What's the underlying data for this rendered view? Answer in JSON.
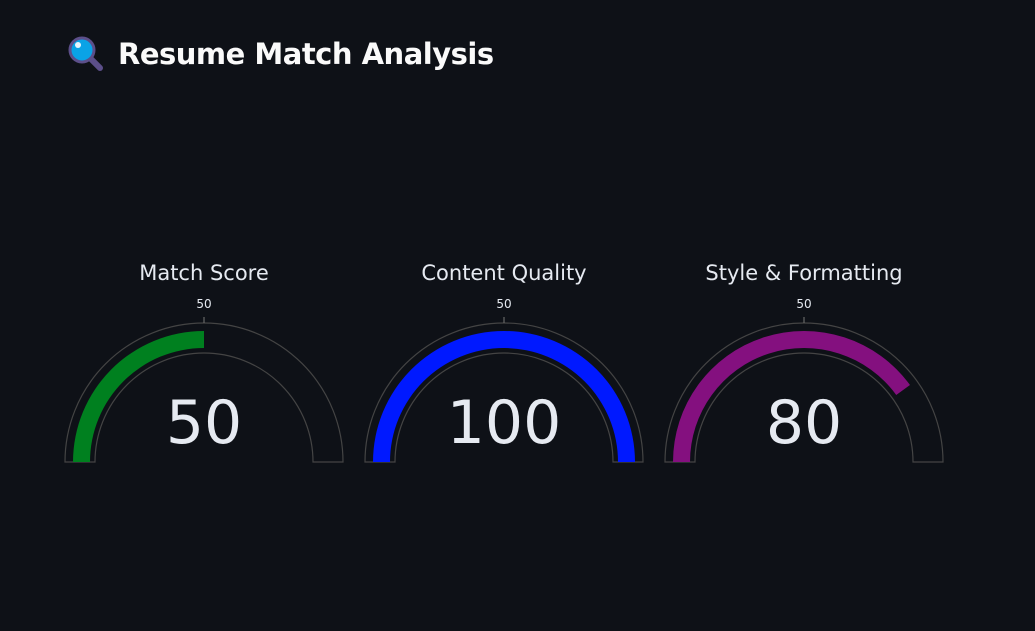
{
  "header": {
    "icon": "magnifying-glass-icon",
    "title": "Resume Match Analysis"
  },
  "chart_data": [
    {
      "type": "gauge",
      "title": "Match Score",
      "value": 50,
      "range": [
        0,
        100
      ],
      "tick_labels": [
        "50"
      ],
      "bar_color": "#00801f"
    },
    {
      "type": "gauge",
      "title": "Content Quality",
      "value": 100,
      "range": [
        0,
        100
      ],
      "tick_labels": [
        "50"
      ],
      "bar_color": "#0019ff"
    },
    {
      "type": "gauge",
      "title": "Style & Formatting",
      "value": 80,
      "range": [
        0,
        100
      ],
      "tick_labels": [
        "50"
      ],
      "bar_color": "#84107f"
    }
  ]
}
